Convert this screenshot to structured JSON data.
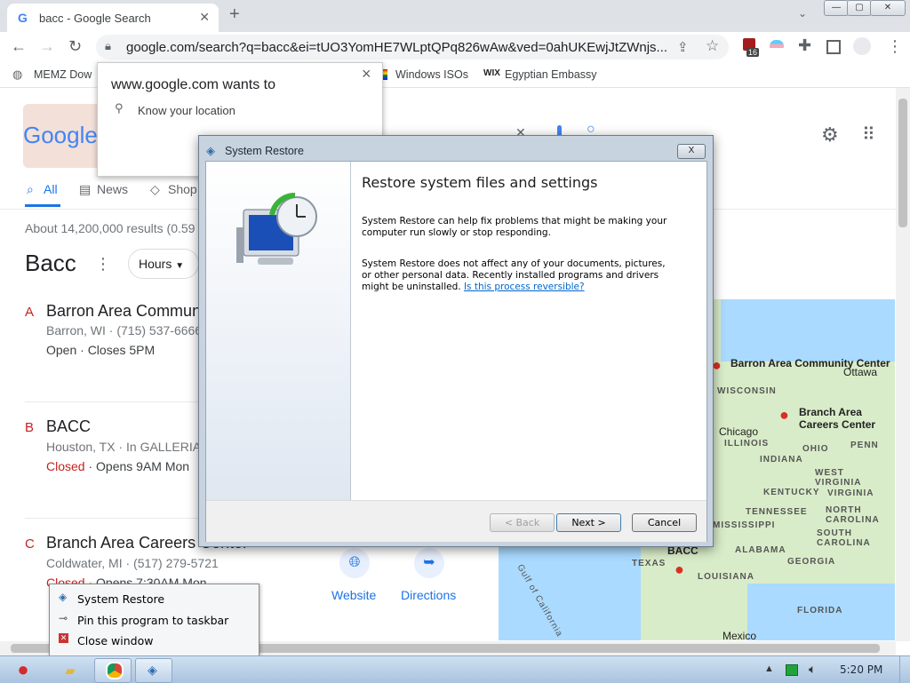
{
  "browser": {
    "tab_title": "bacc - Google Search",
    "new_tab_label": "+",
    "url": "google.com/search?q=bacc&ei=tUO3YomHE7WLptQPq826wAw&ved=0ahUKEwjJtZWnjs...",
    "extension_badge": "16",
    "bookmarks": [
      "MEMZ Dow",
      "Windows ISOs",
      "Egyptian Embassy"
    ]
  },
  "location_prompt": {
    "title": "www.google.com wants to",
    "item": "Know your location",
    "close_label": "×"
  },
  "google": {
    "logo": "Google",
    "tabs": [
      "All",
      "News",
      "Shop"
    ],
    "results_count": "About 14,200,000 results (0.59",
    "query_heading": "Bacc",
    "hours_label": "Hours",
    "results": [
      {
        "letter": "A",
        "title": "Barron Area Commun",
        "line1": "Barron, WI · (715) 537-6666",
        "status": "",
        "line2": "Open · Closes 5PM"
      },
      {
        "letter": "B",
        "title": "BACC",
        "line1": "Houston, TX · In GALLERIA",
        "status": "Closed",
        "line2": " · Opens 9AM Mon"
      },
      {
        "letter": "C",
        "title": "Branch Area Careers Center",
        "line1": "Coldwater, MI · (517) 279-5721",
        "status": "Closed",
        "line2": " · Opens 7:30AM Mon"
      }
    ],
    "actions": {
      "website": "Website",
      "directions": "Directions"
    },
    "map": {
      "pins": [
        "Barron Area Community Center",
        "Branch Area Careers Center",
        "BACC"
      ],
      "cities": [
        "Ottawa",
        "Chicago"
      ],
      "states": [
        "WISCONSIN",
        "ILLINOIS",
        "INDIANA",
        "OHIO",
        "PENN",
        "WEST VIRGINIA",
        "KENTUCKY",
        "VIRGINIA",
        "TENNESSEE",
        "NORTH CAROLINA",
        "SOUTH CAROLINA",
        "GEORGIA",
        "ALABAMA",
        "MISSISSIPPI",
        "LOUISIANA",
        "TEXAS",
        "FLORIDA"
      ],
      "water": "Gulf of California",
      "country": "Mexico"
    }
  },
  "dialog": {
    "title": "System Restore",
    "heading": "Restore system files and settings",
    "para1": "System Restore can help fix problems that might be making your computer run slowly or stop responding.",
    "para2": "System Restore does not affect any of your documents, pictures, or other personal data. Recently installed programs and drivers might be uninstalled.",
    "link": "Is this process reversible?",
    "back": "< Back",
    "next": "Next >",
    "cancel": "Cancel",
    "close": "X"
  },
  "jumplist": {
    "items": [
      "System Restore",
      "Pin this program to taskbar",
      "Close window"
    ]
  },
  "taskbar": {
    "clock": "5:20 PM"
  }
}
